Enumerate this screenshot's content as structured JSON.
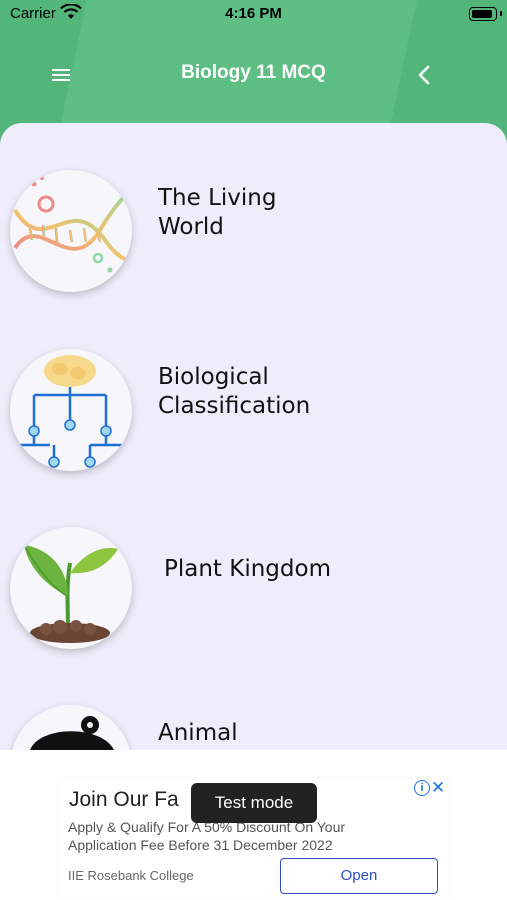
{
  "status": {
    "carrier": "Carrier",
    "time": "4:16 PM"
  },
  "header": {
    "title": "Biology 11 MCQ"
  },
  "chapters": [
    {
      "label": "The Living World",
      "icon": "dna-icon"
    },
    {
      "label": "Biological Classification",
      "icon": "classification-tree-icon"
    },
    {
      "label": "Plant Kingdom",
      "icon": "plant-sprout-icon"
    },
    {
      "label": "Animal",
      "icon": "animal-icon"
    }
  ],
  "ad": {
    "title": "Join Our Fa",
    "description": "Apply & Qualify For A 50% Discount On Your Application Fee Before 31 December 2022",
    "advertiser": "IIE Rosebank College",
    "cta": "Open"
  },
  "toast": {
    "text": "Test mode"
  },
  "colors": {
    "header": "#52b67a",
    "content_bg": "#efedfb",
    "cta": "#2b4cc4"
  }
}
